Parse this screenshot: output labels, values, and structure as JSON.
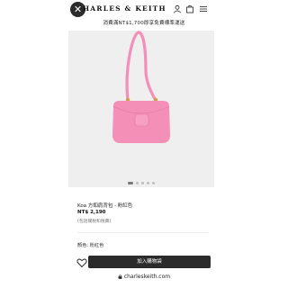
{
  "promo": {
    "text": "消費滿NT$1,700即享免費標準運送"
  },
  "header": {
    "brand": "HARLES & KEITH",
    "close_glyph": "✕"
  },
  "product": {
    "name": "Koa 方釦肩背包 - 粉紅色",
    "price": "NT$ 2,190",
    "tax_note": "(包括關稅和稅費)",
    "color_label": "顏色: 粉紅色",
    "bag_color": "#F48FB8"
  },
  "gallery": {
    "total_images": 5,
    "active_index": 0
  },
  "actions": {
    "add_to_cart": "加入購物袋"
  },
  "browser": {
    "url": "charleskeith.com"
  },
  "colors": {
    "accent_dark": "#2b2b2b",
    "pink": "#F48FB8"
  },
  "icons": [
    "close-icon",
    "user-icon",
    "bag-icon",
    "menu-icon",
    "heart-icon",
    "lock-icon"
  ]
}
